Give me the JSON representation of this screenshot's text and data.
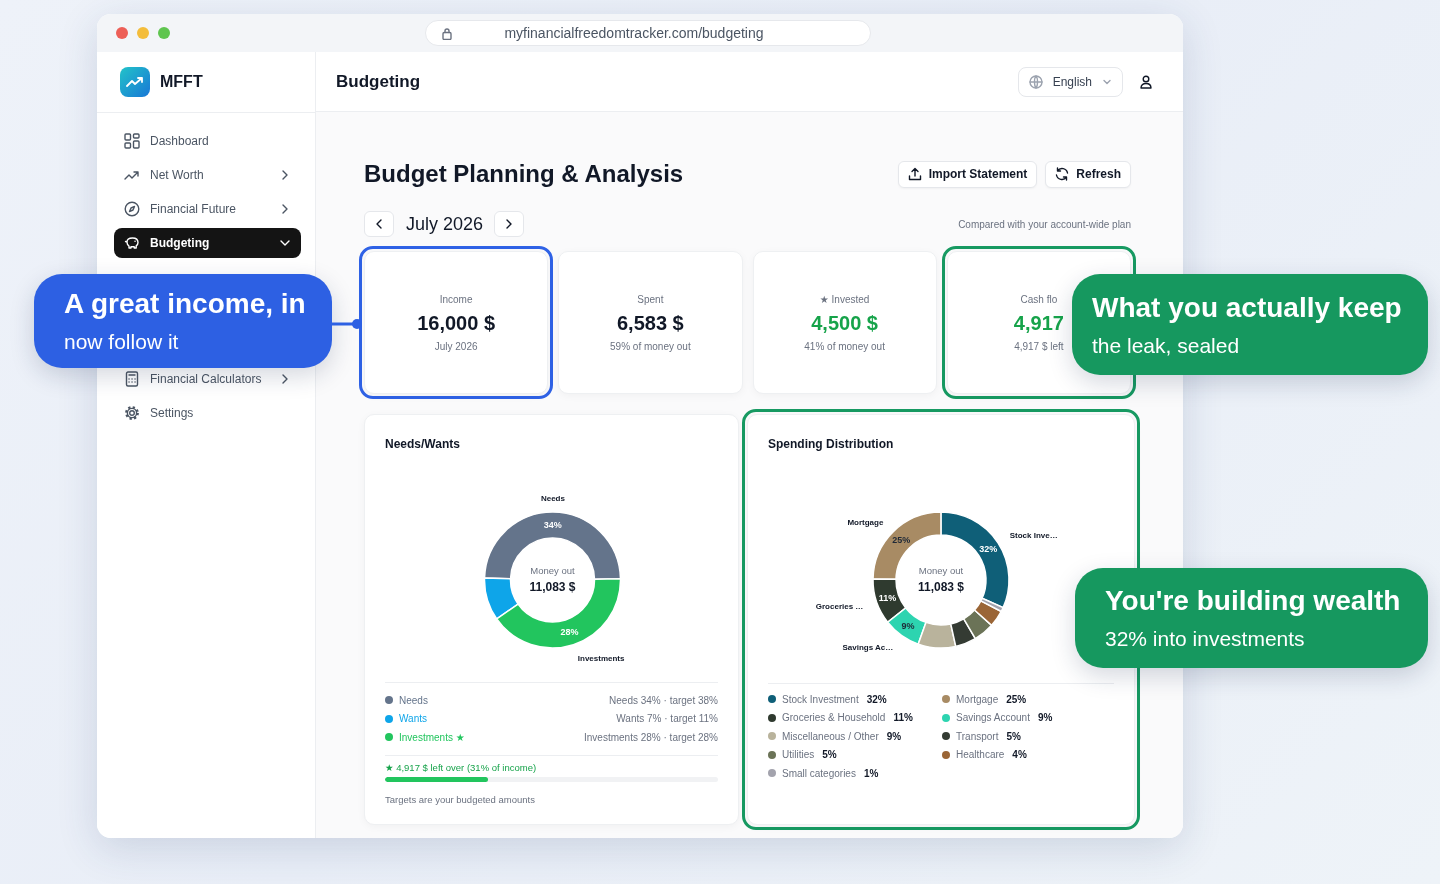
{
  "browser": {
    "url": "myfinancialfreedomtracker.com/budgeting"
  },
  "sidebar": {
    "brand": "MFFT",
    "items": [
      {
        "label": "Dashboard",
        "has_submenu": false,
        "selected": false
      },
      {
        "label": "Net Worth",
        "has_submenu": true,
        "expanded": false,
        "selected": false
      },
      {
        "label": "Financial Future",
        "has_submenu": true,
        "expanded": false,
        "selected": false
      },
      {
        "label": "Budgeting",
        "has_submenu": true,
        "expanded": true,
        "selected": true
      },
      {
        "label": "Financial Calculators",
        "has_submenu": true,
        "expanded": false,
        "selected": false
      },
      {
        "label": "Settings",
        "has_submenu": false,
        "selected": false
      }
    ]
  },
  "header": {
    "title": "Budgeting",
    "language": "English"
  },
  "page": {
    "title": "Budget Planning & Analysis",
    "actions": [
      "Import Statement",
      "Refresh"
    ],
    "month": "July 2026",
    "note": "Compared with your account-wide plan"
  },
  "cards": [
    {
      "label": "Income",
      "value": "16,000 $",
      "caption": "July 2026",
      "positive": false,
      "highlight": {
        "color": "#2f62e6"
      }
    },
    {
      "label": "Spent",
      "value": "6,583 $",
      "caption": "59% of money out",
      "positive": false
    },
    {
      "label": "★ Invested",
      "value": "4,500 $",
      "caption": "41% of money out",
      "positive": true
    },
    {
      "label": "Cash flo",
      "value": "4,917",
      "caption": "4,917 $ left",
      "positive": true,
      "highlight": {
        "color": "#179a62"
      }
    }
  ],
  "needs_wants": {
    "title": "Needs/Wants",
    "center_label": "Money out",
    "center_value": "11,083 $",
    "chart_data": {
      "type": "donut",
      "categories": [
        "Needs",
        "Wants",
        "Investments"
      ],
      "values": [
        34,
        7,
        28
      ],
      "colors": [
        "#64748b",
        "#0ea5e9",
        "#22c55e"
      ],
      "value_labels": [
        "34%",
        null,
        "28%"
      ],
      "annotations": [
        "Needs",
        null,
        "Investments"
      ],
      "legend": [
        {
          "detail": "Needs 34% · target 38%"
        },
        {
          "detail": "Wants 7% · target 11%"
        },
        {
          "suffix": "★",
          "detail": "Investments 28% · target 28%"
        }
      ]
    },
    "leftover": {
      "text": "★ 4,917 $ left over (31% of income)",
      "level": 0.31
    },
    "footnote": "Targets are your budgeted amounts"
  },
  "spending": {
    "title": "Spending Distribution",
    "center_label": "Money out",
    "center_value": "11,083 $",
    "highlight": {
      "color": "#179a62"
    },
    "chart_data": {
      "type": "donut",
      "categories": [
        "Stock Investment",
        "Mortgage",
        "Groceries & Household",
        "Savings Account",
        "Miscellaneous / Other",
        "Transport",
        "Utilities",
        "Healthcare",
        "Small categories"
      ],
      "values": [
        32,
        25,
        11,
        9,
        9,
        5,
        5,
        4,
        1
      ],
      "colors": [
        "#0f5f78",
        "#a88b64",
        "#2f3a2f",
        "#2dd4b0",
        "#b9b39c",
        "#343b33",
        "#6b7357",
        "#9a6536",
        "#a3a3ad"
      ],
      "value_labels": [
        "32%",
        "25%",
        "11%",
        "9%",
        null,
        null,
        null,
        null,
        null
      ],
      "annotations": [
        "Stock Inve…",
        "Mortgage",
        "Groceries …",
        "Savings Ac…",
        null,
        null,
        null,
        null,
        null
      ],
      "legend": [
        {
          "value": "32%"
        },
        {
          "value": "25%"
        },
        {
          "value": "11%"
        },
        {
          "value": "9%"
        },
        {
          "value": "9%"
        },
        {
          "value": "5%"
        },
        {
          "value": "5%"
        },
        {
          "value": "4%"
        },
        {
          "value": "1%"
        }
      ]
    }
  },
  "callouts": [
    {
      "title": "A great income, in",
      "subtitle": "now follow it",
      "color": "#2d60e3",
      "connector": true
    },
    {
      "title": "What you actually keep",
      "subtitle": "the leak, sealed",
      "color": "#16985f",
      "connector": false
    },
    {
      "title": "You're building wealth",
      "subtitle": "32% into investments",
      "color": "#16985f",
      "connector": false
    }
  ]
}
